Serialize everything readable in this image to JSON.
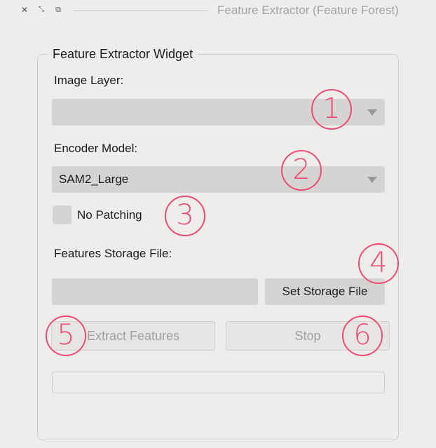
{
  "window": {
    "title": "Feature Extractor (Feature Forest)",
    "controls": {
      "close": "✕",
      "minimize": "⤡",
      "float": "⧉"
    }
  },
  "widget": {
    "group_title": "Feature Extractor Widget",
    "image_layer": {
      "label": "Image Layer:",
      "value": ""
    },
    "encoder_model": {
      "label": "Encoder Model:",
      "value": "SAM2_Large"
    },
    "no_patching": {
      "label": "No Patching",
      "checked": false
    },
    "storage": {
      "label": "Features Storage File:",
      "path": "",
      "button": "Set Storage File"
    },
    "extract_button": "Extract Features",
    "stop_button": "Stop",
    "progress": 0
  },
  "callouts": [
    "1",
    "2",
    "3",
    "4",
    "5",
    "6"
  ],
  "colors": {
    "background": "#efedeb",
    "control": "#d6d4d2",
    "callout": "#ec4b78",
    "disabled_text": "#a2a09e"
  }
}
